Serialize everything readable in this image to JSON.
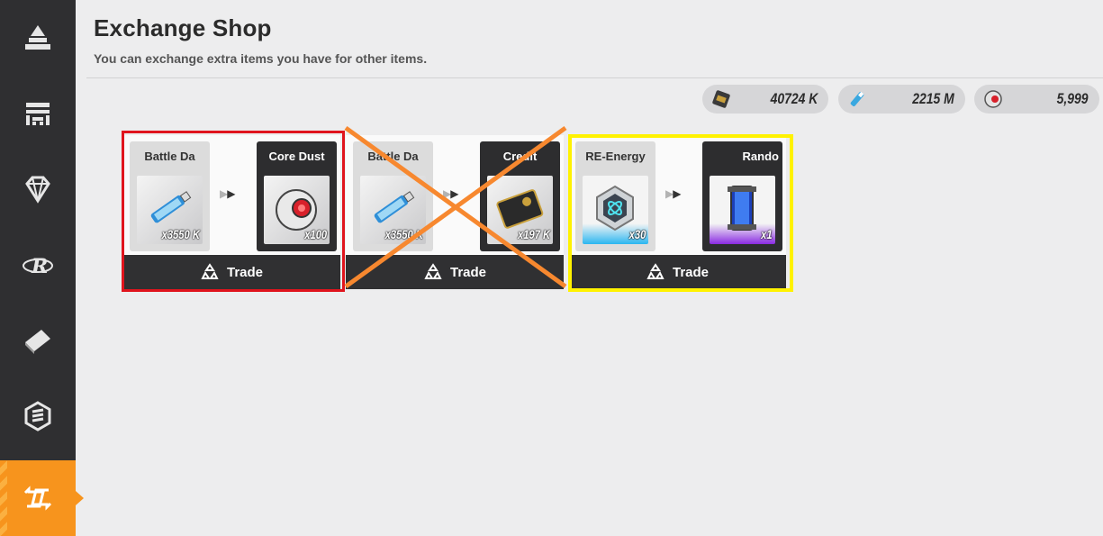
{
  "page": {
    "title": "Exchange Shop",
    "subtitle": "You can exchange extra items you have for other items."
  },
  "sidebar": {
    "items": [
      {
        "icon": "anvil-icon"
      },
      {
        "icon": "shop-icon"
      },
      {
        "icon": "diamond-icon"
      },
      {
        "icon": "r-logo-icon"
      },
      {
        "icon": "ticket-icon"
      },
      {
        "icon": "hex-badge-icon"
      },
      {
        "icon": "exchange-icon",
        "active": true
      }
    ],
    "accent": "#f7941d"
  },
  "currencies": [
    {
      "icon": "credit-card-icon",
      "value": "40724 K"
    },
    {
      "icon": "battle-data-icon",
      "value": "2215 M"
    },
    {
      "icon": "core-dust-icon",
      "value": "5,999"
    }
  ],
  "trades": [
    {
      "give": {
        "label": "Battle Da",
        "qty": "x3550 K",
        "icon": "usb-drive-icon"
      },
      "get": {
        "label": "Core Dust",
        "qty": "x100",
        "icon": "core-orb-icon"
      },
      "button": "Trade",
      "annotation": "red-box"
    },
    {
      "give": {
        "label": "Battle Da",
        "qty": "x3550 K",
        "icon": "usb-drive-icon"
      },
      "get": {
        "label": "Credit",
        "qty": "x197 K",
        "icon": "credit-card-icon"
      },
      "button": "Trade",
      "annotation": "orange-x"
    },
    {
      "give": {
        "label": "RE-Energy",
        "qty": "x30",
        "icon": "energy-hex-icon"
      },
      "get": {
        "label": "Rando",
        "qty": "x1",
        "icon": "random-box-icon"
      },
      "button": "Trade",
      "annotation": "yellow-box"
    }
  ],
  "colors": {
    "background": "#ededee",
    "sidebar": "#2f2f31",
    "highlight_red": "#e0141d",
    "highlight_yellow": "#fff200",
    "cross_orange": "#f7882f"
  }
}
